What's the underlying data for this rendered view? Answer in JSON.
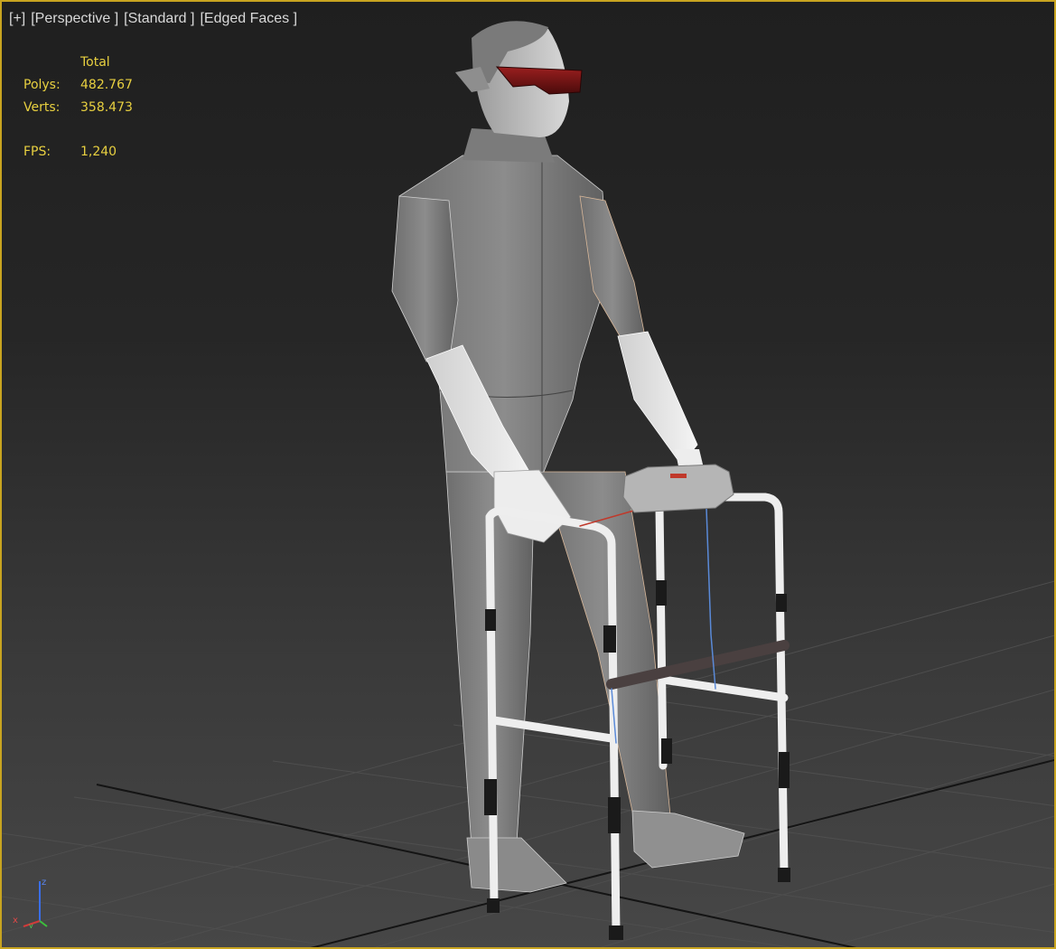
{
  "viewport": {
    "labels": [
      "[+]",
      "[Perspective ]",
      "[Standard ]",
      "[Edged Faces ]"
    ],
    "border_color": "#c8a420"
  },
  "stats": {
    "header": "Total",
    "polys_label": "Polys:",
    "polys_value": "482.767",
    "verts_label": "Verts:",
    "verts_value": "358.473",
    "fps_label": "FPS:",
    "fps_value": "1,240",
    "color": "#e8d040"
  },
  "gizmo": {
    "z": "z",
    "x": "x",
    "y": "y"
  }
}
